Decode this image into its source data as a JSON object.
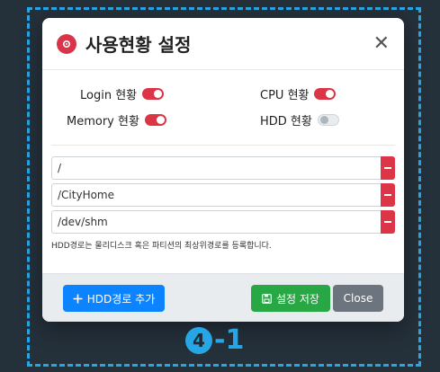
{
  "modal": {
    "title": "사용현황 설정",
    "close_symbol": "✕",
    "header_icon": "gear-icon",
    "accent_color": "#dc3545"
  },
  "toggles": [
    {
      "label": "Login 현황",
      "on": true
    },
    {
      "label": "CPU 현황",
      "on": true
    },
    {
      "label": "Memory 현황",
      "on": true
    },
    {
      "label": "HDD 현황",
      "on": false
    }
  ],
  "paths": [
    {
      "value": "/"
    },
    {
      "value": "/CityHome"
    },
    {
      "value": "/dev/shm"
    }
  ],
  "hint": "HDD경로는 물리디스크 혹은 파티션의 최상위경로를 등록합니다.",
  "footer": {
    "add_label": "HDD경로 추가",
    "save_label": "설정 저장",
    "close_label": "Close"
  },
  "annotation": {
    "number": "4",
    "suffix": "-1",
    "color": "#27a6e6"
  }
}
